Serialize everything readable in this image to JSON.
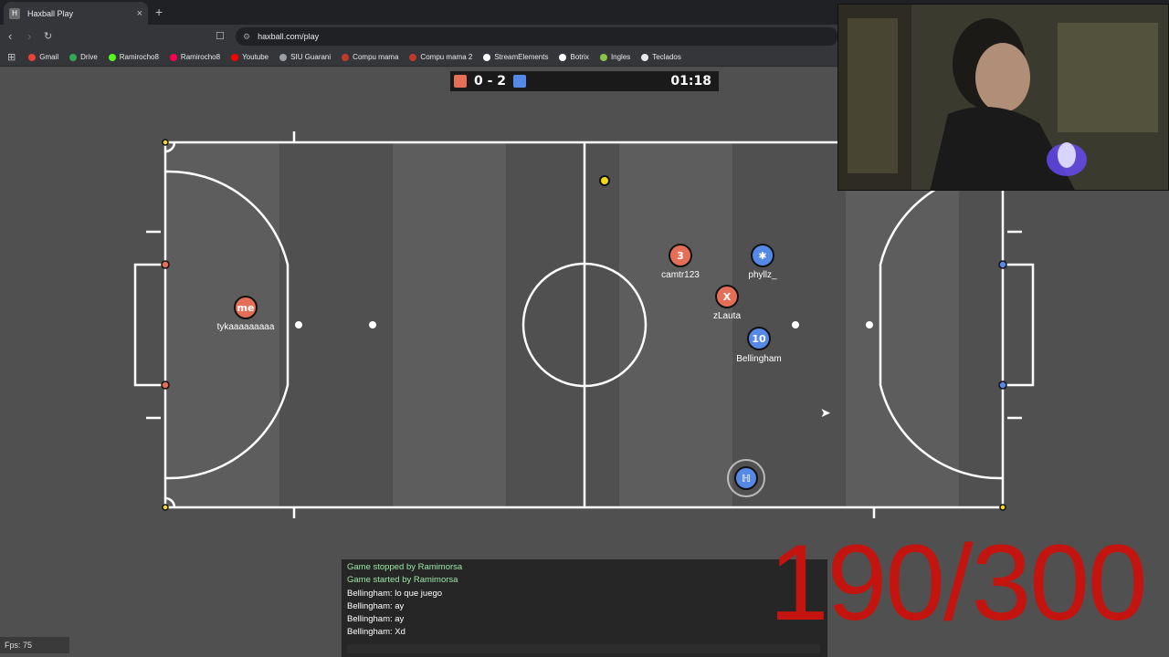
{
  "browser": {
    "tab_title": "Haxball Play",
    "tab_close": "×",
    "new_tab": "+",
    "url": "haxball.com/play",
    "bookmarks": [
      {
        "label": "Gmail",
        "color": "#ea4335"
      },
      {
        "label": "Drive",
        "color": "#34a853"
      },
      {
        "label": "Ramirocho8",
        "color": "#53fc18"
      },
      {
        "label": "Ramirocho8",
        "color": "#ff0050"
      },
      {
        "label": "Youtube",
        "color": "#ff0000"
      },
      {
        "label": "SIU Guarani",
        "color": "#9aa0a6"
      },
      {
        "label": "Compu mama",
        "color": "#c0392b"
      },
      {
        "label": "Compu mama 2",
        "color": "#c0392b"
      },
      {
        "label": "StreamElements",
        "color": "#ffffff"
      },
      {
        "label": "Botrix",
        "color": "#ffffff"
      },
      {
        "label": "Ingles",
        "color": "#8bc34a"
      },
      {
        "label": "Teclados",
        "color": "#e8eaed"
      }
    ]
  },
  "scoreboard": {
    "score": "0 - 2",
    "time": "01:18",
    "red_color": "#e56e56",
    "blue_color": "#5689e5"
  },
  "players": [
    {
      "avatar": "me",
      "name": "tykaaaaaaaaa",
      "team": "red"
    },
    {
      "avatar": "3",
      "name": "camtr123",
      "team": "red"
    },
    {
      "avatar": "X",
      "name": "zLauta",
      "team": "red"
    },
    {
      "avatar": "✱",
      "name": "phyllz_",
      "team": "blue"
    },
    {
      "avatar": "10",
      "name": "Bellingham",
      "team": "blue"
    },
    {
      "avatar": "ℍ",
      "name": "",
      "team": "blue"
    }
  ],
  "chat": {
    "lines": [
      {
        "text": "Game stopped by Ramimorsa",
        "type": "system"
      },
      {
        "text": "Game started by Ramimorsa",
        "type": "system"
      },
      {
        "text": "Bellingham: lo que juego",
        "type": "player"
      },
      {
        "text": "Bellingham: ay",
        "type": "player"
      },
      {
        "text": "Bellingham: ay",
        "type": "player"
      },
      {
        "text": "Bellingham: Xd",
        "type": "player"
      }
    ]
  },
  "overlay": {
    "counter": "190/300"
  },
  "fps": "Fps: 75"
}
